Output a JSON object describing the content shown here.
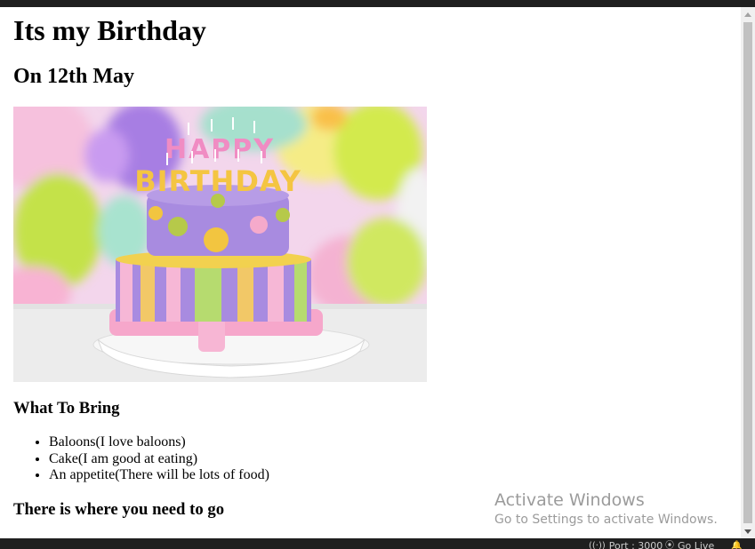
{
  "page": {
    "heading": "Its my Birthday",
    "subheading": "On 12th May",
    "image_alt": "Happy Birthday cake with candles in front of colorful balloons",
    "cake_candles_text": "HAPPY BIRTHDAY",
    "bring_heading": "What To Bring",
    "bring_items": [
      "Baloons(I love baloons)",
      "Cake(I am good at eating)",
      "An appetite(There will be lots of food)"
    ],
    "where_heading": "There is where you need to go"
  },
  "watermark": {
    "title": "Activate Windows",
    "subtitle": "Go to Settings to activate Windows."
  },
  "status_bar": {
    "port_label": "Port : 3000",
    "golive_label": "Go Live",
    "port_icon": "broadcast-icon",
    "golive_icon": "golive-icon",
    "bell_icon": "bell-icon"
  }
}
